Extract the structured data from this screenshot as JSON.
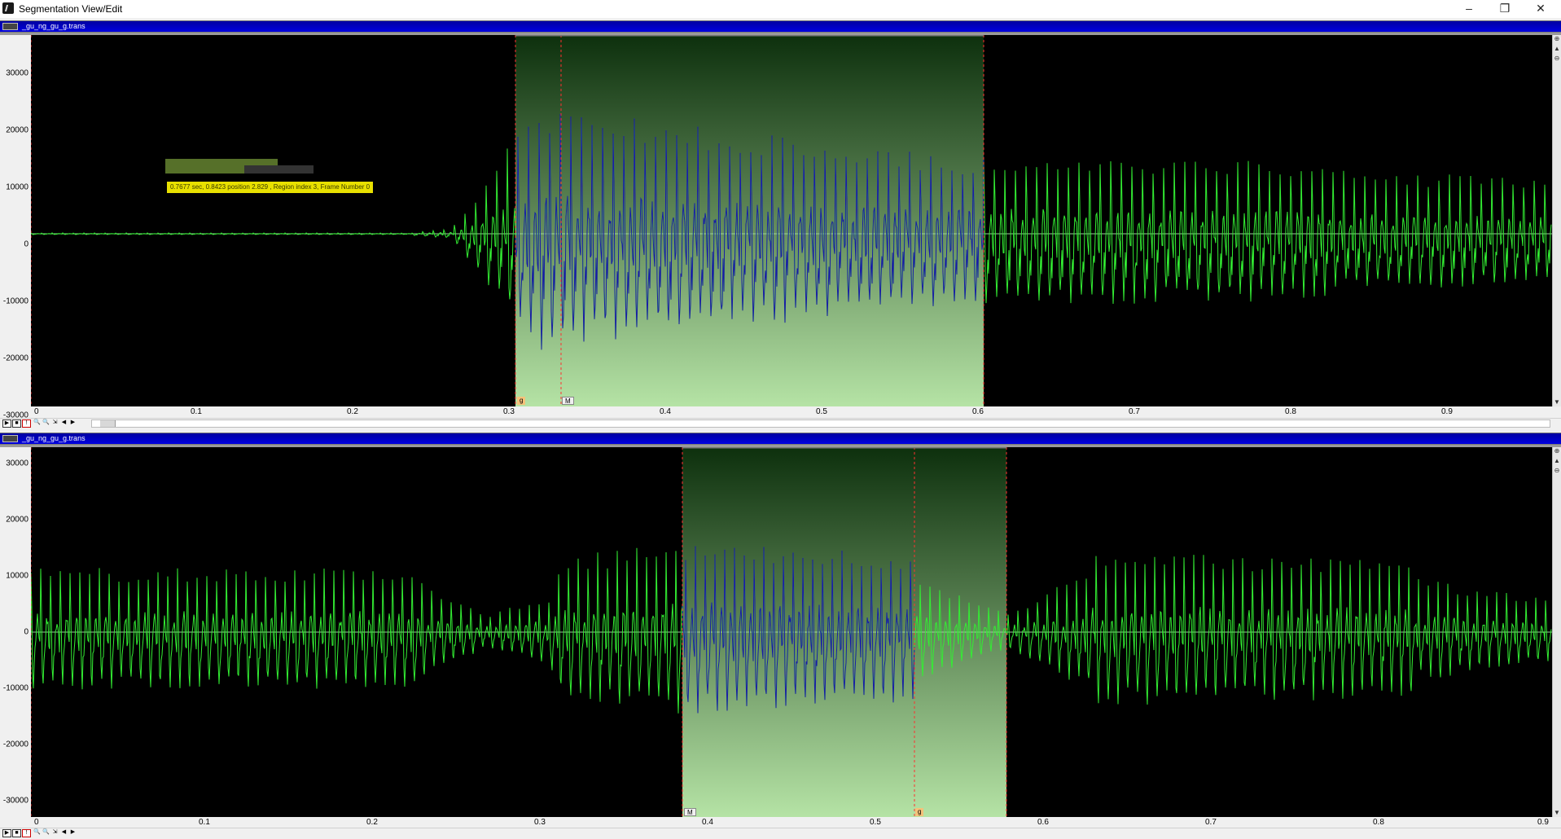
{
  "window": {
    "title": "Segmentation View/Edit",
    "buttons": [
      "–",
      "❐",
      "✕"
    ]
  },
  "panes": [
    {
      "title": "_gu_ng_gu_g.trans",
      "y_ticks": [
        "30000",
        "20000",
        "10000",
        "0",
        "-10000",
        "-20000",
        "-30000"
      ],
      "x_ticks": [
        "0",
        "0.1",
        "0.2",
        "0.3",
        "0.4",
        "0.5",
        "0.6",
        "0.7",
        "0.8",
        "0.9"
      ],
      "markers": [
        {
          "label": "g",
          "type": "g"
        },
        {
          "label": "M",
          "type": "m"
        }
      ],
      "tooltip": "0.7677 sec, 0.8423 position 2.829 , Region index 3, Frame Number 0"
    },
    {
      "title": "_gu_ng_gu_g.trans",
      "y_ticks": [
        "30000",
        "20000",
        "10000",
        "0",
        "-10000",
        "-20000",
        "-30000"
      ],
      "x_ticks": [
        "0",
        "0.1",
        "0.2",
        "0.3",
        "0.4",
        "0.5",
        "0.6",
        "0.7",
        "0.8",
        "0.9"
      ],
      "markers": [
        {
          "label": "M",
          "type": "m"
        },
        {
          "label": "g",
          "type": "g"
        }
      ]
    }
  ],
  "colors": {
    "waveform": "#33ee33",
    "selected_waveform": "#1a1aa8",
    "boundary": "#ff3030",
    "titlebar": "#0000c0"
  },
  "toolbar_icons": [
    "play-icon",
    "stop-icon",
    "record-icon",
    "zoom-in-icon",
    "zoom-out-icon",
    "fit-icon",
    "scroll-left-icon",
    "scroll-right-icon"
  ]
}
